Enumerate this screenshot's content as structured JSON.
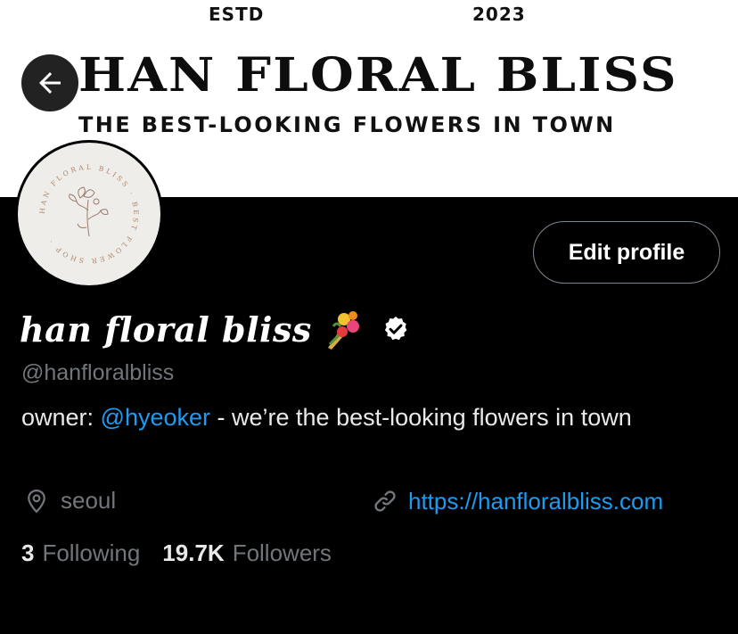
{
  "banner": {
    "estd_label": "ESTD",
    "estd_year": "2023",
    "brand_title": "HAN FLORAL BLISS",
    "tagline": "THE BEST-LOOKING FLOWERS IN TOWN"
  },
  "avatar": {
    "ring_text": "HAN FLORAL BLISS · BEST FLOWER SHOP ·"
  },
  "actions": {
    "edit_profile": "Edit profile"
  },
  "profile": {
    "display_name": "han floral bliss",
    "handle": "@hanfloralbliss",
    "bio_prefix": "owner: ",
    "bio_mention": "@hyeoker",
    "bio_suffix": " - we’re the best-looking flowers in town",
    "location": "seoul",
    "website": "https://hanfloralbliss.com"
  },
  "stats": {
    "following_count": "3",
    "following_label": "Following",
    "followers_count": "19.7K",
    "followers_label": "Followers"
  },
  "colors": {
    "background": "#000000",
    "accent": "#1d9bf0",
    "muted": "#71767b",
    "text": "#e7e9ea"
  },
  "icons": {
    "back": "arrow-left-icon",
    "verified": "verified-badge-icon",
    "location": "location-pin-icon",
    "link": "link-icon",
    "emoji": "bouquet-icon"
  }
}
